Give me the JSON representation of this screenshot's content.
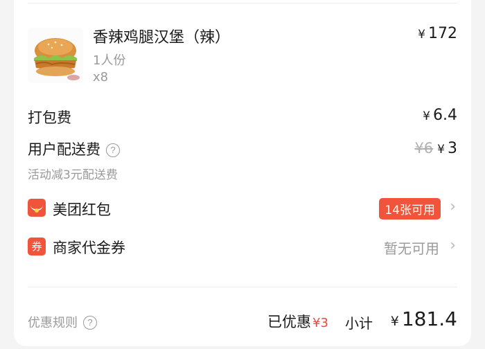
{
  "item": {
    "name": "香辣鸡腿汉堡（辣）",
    "spec": "1人份",
    "qty": "x8",
    "currency": "¥",
    "price": "172",
    "image_icon": "burger-icon"
  },
  "packing_fee": {
    "label": "打包费",
    "currency": "¥",
    "value": "6.4"
  },
  "delivery_fee": {
    "label": "用户配送费",
    "help": "?",
    "original": "¥6",
    "currency": "¥",
    "value": "3",
    "note": "活动减3元配送费"
  },
  "coupons": [
    {
      "label": "美团红包",
      "icon": "red-packet-icon",
      "status": "14张可用",
      "chevron": "›"
    },
    {
      "label": "商家代金券",
      "icon": "voucher-icon",
      "icon_text": "券",
      "status": "暂无可用",
      "chevron": "›"
    }
  ],
  "footer": {
    "rules_label": "优惠规则",
    "rules_help": "?",
    "discount_label": "已优惠",
    "discount_amount": "¥3",
    "subtotal_label": "小计",
    "subtotal_currency": "¥",
    "subtotal_value": "181.4"
  },
  "colors": {
    "accent": "#f0553c",
    "discount": "#e8493b",
    "muted": "#9a9a9a"
  }
}
